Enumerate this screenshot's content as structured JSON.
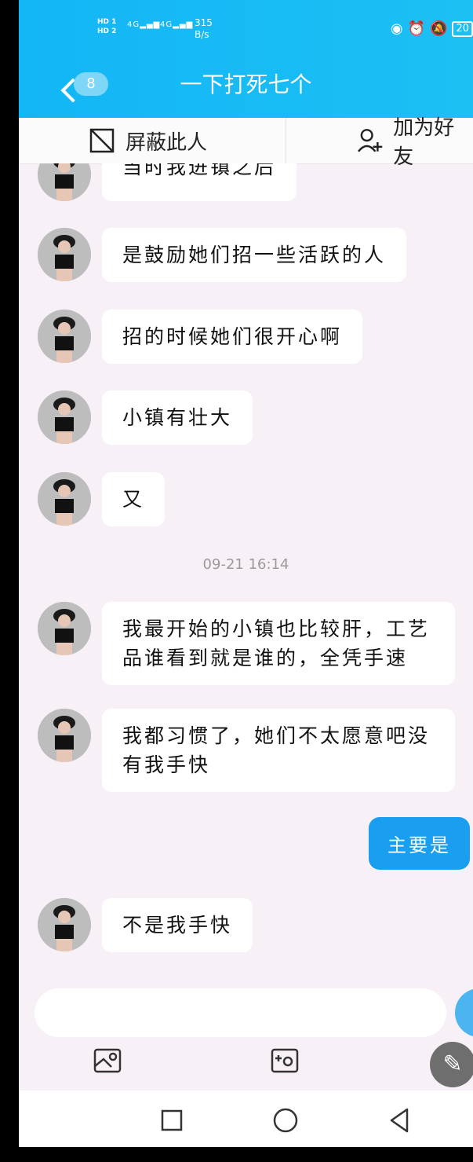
{
  "status_bar": {
    "hd_top": "HD 1",
    "hd_bottom": "HD 2",
    "signal1": "4G",
    "signal2": "4G",
    "speed_value": "315",
    "speed_unit": "B/s",
    "battery": "20"
  },
  "header": {
    "back_badge": "8",
    "title": "一下打死七个"
  },
  "actions": {
    "block_label": "屏蔽此人",
    "add_friend_label": "加为好友"
  },
  "messages": [
    {
      "direction": "in",
      "text": "当时我进镇之后"
    },
    {
      "direction": "in",
      "text": "是鼓励她们招一些活跃的人"
    },
    {
      "direction": "in",
      "text": "招的时候她们很开心啊"
    },
    {
      "direction": "in",
      "text": "小镇有壮大"
    },
    {
      "direction": "in",
      "text": "又"
    },
    {
      "direction": "in",
      "text": "我最开始的小镇也比较肝，工艺品谁看到就是谁的，全凭手速"
    },
    {
      "direction": "in",
      "text": "我都习惯了，她们不太愿意吧没有我手快"
    },
    {
      "direction": "out",
      "text": "主要是"
    },
    {
      "direction": "in",
      "text": "不是我手快"
    }
  ],
  "timestamp": "09-21 16:14",
  "icons": {
    "back": "chevron-left-icon",
    "block": "block-icon",
    "add_friend": "add-friend-icon",
    "image": "image-icon",
    "camera": "camera-icon",
    "edit": "pencil-icon",
    "nav_recent": "square-icon",
    "nav_home": "circle-icon",
    "nav_back": "triangle-icon"
  },
  "colors": {
    "header": "#1cc0f3",
    "outgoing_bubble": "#1a9ff0",
    "background": "#f7f1f7"
  }
}
